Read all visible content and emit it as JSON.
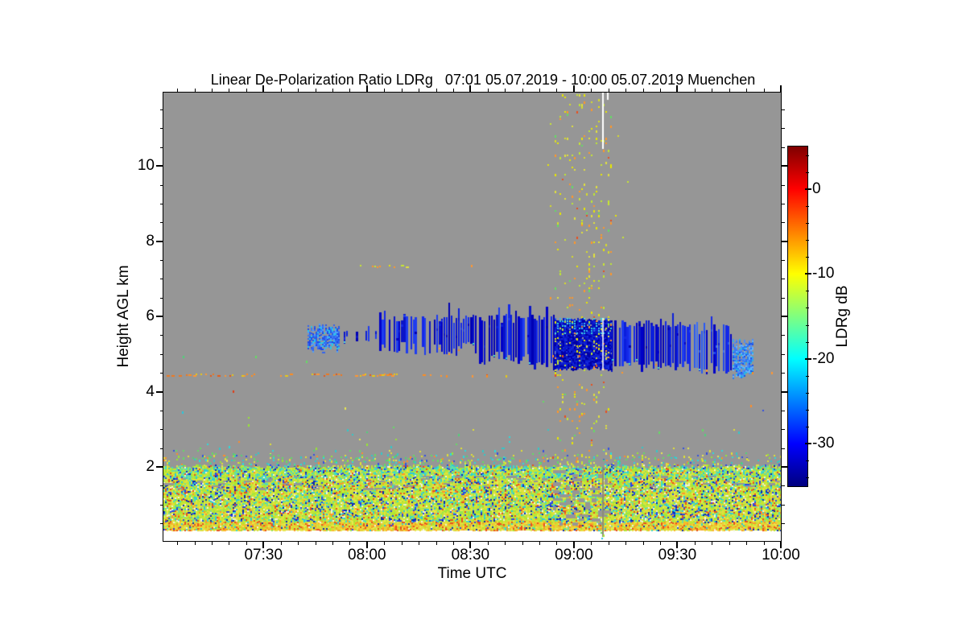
{
  "chart_data": {
    "type": "heatmap",
    "title": "Linear De-Polarization Ratio LDRg   07:01 05.07.2019 - 10:00 05.07.2019 Muenchen",
    "xlabel": "Time UTC",
    "ylabel": "Height AGL km",
    "site": "Muenchen",
    "time_range": {
      "start": "07:01 05.07.2019",
      "end": "10:00 05.07.2019"
    },
    "x_axis": {
      "unit": "UTC",
      "start_minutes": 421,
      "end_minutes": 600,
      "major_ticks": [
        {
          "t": 450,
          "label": "07:30"
        },
        {
          "t": 480,
          "label": "08:00"
        },
        {
          "t": 510,
          "label": "08:30"
        },
        {
          "t": 540,
          "label": "09:00"
        },
        {
          "t": 570,
          "label": "09:30"
        },
        {
          "t": 600,
          "label": "10:00"
        }
      ],
      "minor_step_minutes": 5
    },
    "y_axis": {
      "unit": "km",
      "min": 0,
      "max": 11.95,
      "major_ticks": [
        {
          "h": 2,
          "label": "2"
        },
        {
          "h": 4,
          "label": "4"
        },
        {
          "h": 6,
          "label": "6"
        },
        {
          "h": 8,
          "label": "8"
        },
        {
          "h": 10,
          "label": "10"
        }
      ],
      "minor_step_km": 0.5,
      "data_min_height_km": 0.31
    },
    "colorbar": {
      "label": "LDRg dB",
      "min": -35,
      "max": 5,
      "major_ticks": [
        {
          "v": 0,
          "label": "0"
        },
        {
          "v": -10,
          "label": "-10"
        },
        {
          "v": -20,
          "label": "-20"
        },
        {
          "v": -30,
          "label": "-30"
        }
      ],
      "minor_step_db": 2,
      "stops": [
        [
          0,
          "#00007F"
        ],
        [
          0.125,
          "#0000FF"
        ],
        [
          0.375,
          "#00FFFF"
        ],
        [
          0.625,
          "#FFFF00"
        ],
        [
          0.875,
          "#FF0000"
        ],
        [
          1,
          "#7F0000"
        ]
      ]
    },
    "background_nodata_color": "#969696",
    "palettes": {
      "column": [
        "#E8E800",
        "#E1E13C",
        "#E8E800",
        "#D7DC28",
        "#BEE632",
        "#E8E800",
        "#C8E632",
        "#FF9628",
        "#64DC64",
        "#E1E13C",
        "#E8E800",
        "#BEE632",
        "#FF9628",
        "#E8501E"
      ],
      "fringe": [
        "#64DC64",
        "#32C8C8",
        "#E1E132",
        "#3250E1",
        "#FF8C28",
        "#96E632",
        "#28DCDC",
        "#64DC64",
        "#E1E132",
        "#32C8C8",
        "#50D278",
        "#E8E850"
      ],
      "greens": [
        "#64DC64",
        "#50D278",
        "#78DC96"
      ],
      "oranges": [
        "#FF8C1E",
        "#F0781E",
        "#E85A14",
        "#E8C814",
        "#FF9632"
      ],
      "yellows": [
        "#E8E800",
        "#C8E632",
        "#FF9628",
        "#E1E13C"
      ],
      "blues": [
        "#0000C8",
        "#0A1EDC",
        "#1428E8",
        "#0000B4",
        "#1E3CF0",
        "#0A14C8"
      ],
      "blues2": [
        "#0A1EDC",
        "#1E46F0",
        "#2858F5",
        "#0000C8",
        "#3C6EF5",
        "#1428E8"
      ],
      "lightblues": [
        "#3C78F0",
        "#2858E8",
        "#50A0FA",
        "#1E46E8",
        "#28C8E8",
        "#3264F0"
      ],
      "lightblues2": [
        "#3C78F0",
        "#508CF5",
        "#28B4E8",
        "#1E50E8",
        "#64B4FA",
        "#2878F0"
      ],
      "blues_dark": [
        "#0000B4",
        "#0A14C8",
        "#0000A0",
        "#1428DC",
        "#0A1EC8"
      ],
      "cap": [
        "#28C8E8",
        "#3CB4F0",
        "#50DCE1",
        "#2864F5",
        "#32D7D7"
      ],
      "cyan_accent": [
        "#28DCDC",
        "#3CE1C8",
        "#50DCE1"
      ],
      "orange_accent": [
        "#FF9628",
        "#F0821E"
      ],
      "bottom_low": [
        "#E8D232",
        "#E8E13C",
        "#FFB428",
        "#E8E850",
        "#F0A028",
        "#E1D23C",
        "#E8501E"
      ],
      "bottom_mid": [
        "#E1E13C",
        "#D7E146",
        "#C8E632",
        "#BEE632",
        "#A8E632",
        "#E1E13C",
        "#C8E632",
        "#96E650",
        "#3CDCC8",
        "#28C8DC",
        "#E1E13C",
        "#BEE632",
        "#FF9628",
        "#E8501E",
        "#2846E8",
        "#A8E632",
        "#C8E632",
        "#78DC96",
        "#E8E850",
        "#0A28B4",
        "#F0F0DC"
      ],
      "bottom_top": [
        "#3CDCC8",
        "#28C8DC",
        "#50E1B4",
        "#78DC96",
        "#A8E632",
        "#C8E632",
        "#64DCA0",
        "#E1E13C",
        "#2846E8",
        "#BEE632",
        "#3CDCC8",
        "#96E650"
      ]
    },
    "features": [
      {
        "type": "bottom_layer",
        "t": [
          421,
          600
        ],
        "h": [
          0.31,
          2.0
        ]
      },
      {
        "type": "gray_dashes",
        "t": [
          421,
          600
        ],
        "h": [
          1.42,
          1.75
        ],
        "density": 0.1
      },
      {
        "type": "gray_blocks",
        "t": [
          534,
          550
        ],
        "h": [
          0.5,
          1.9
        ],
        "density": 0.3
      },
      {
        "type": "vline_gray",
        "t": 548.2,
        "h": [
          0.12,
          2.0
        ],
        "color": "#8C8C78"
      },
      {
        "type": "speckle",
        "t": [
          421,
          600
        ],
        "h": [
          2.0,
          2.5
        ],
        "density": 0.05,
        "palette": "fringe"
      },
      {
        "type": "speckle",
        "t": [
          421,
          600
        ],
        "h": [
          2.5,
          3.0
        ],
        "density": 0.012,
        "palette": "fringe"
      },
      {
        "type": "speckle",
        "t": [
          421,
          600
        ],
        "h": [
          3.0,
          3.7
        ],
        "density": 0.003,
        "palette": "fringe"
      },
      {
        "type": "speckle",
        "t": [
          421,
          481
        ],
        "h": [
          4.78,
          4.95
        ],
        "density": 0.02,
        "palette": "greens"
      },
      {
        "type": "cloud_patch",
        "t": [
          463,
          472
        ],
        "h": [
          5.05,
          5.8
        ],
        "density": 0.82,
        "palette": "lightblues"
      },
      {
        "type": "vstreaks",
        "t": [
          472,
          483
        ],
        "top": [
          5.5,
          5.7
        ],
        "base": [
          5.25,
          5.45
        ],
        "density": 0.3,
        "palette": "blues"
      },
      {
        "type": "vstreaks",
        "t": [
          483,
          494
        ],
        "top": [
          5.75,
          6.0
        ],
        "base": [
          5.0,
          5.35
        ],
        "density": 0.6,
        "palette": "blues"
      },
      {
        "type": "vstreaks",
        "t": [
          494,
          512
        ],
        "top": [
          5.8,
          6.05
        ],
        "base": [
          4.95,
          5.3
        ],
        "density": 0.72,
        "palette": "blues"
      },
      {
        "type": "vstreaks",
        "t": [
          512,
          527
        ],
        "top": [
          5.8,
          6.05
        ],
        "base": [
          4.7,
          5.1
        ],
        "density": 0.78,
        "palette": "blues"
      },
      {
        "type": "vstreaks",
        "t": [
          527,
          535
        ],
        "top": [
          5.85,
          6.05
        ],
        "base": [
          4.55,
          4.9
        ],
        "density": 0.85,
        "palette": "blues"
      },
      {
        "type": "cloud_block",
        "t": [
          534.6,
          551
        ],
        "h": [
          4.55,
          5.95
        ],
        "cap": [
          5.55,
          5.95
        ]
      },
      {
        "type": "vstreaks",
        "t": [
          551,
          572
        ],
        "top": [
          5.7,
          5.95
        ],
        "base": [
          4.5,
          4.8
        ],
        "density": 0.8,
        "palette": "blues"
      },
      {
        "type": "vstreaks",
        "t": [
          572,
          586
        ],
        "top": [
          5.5,
          5.85
        ],
        "base": [
          4.45,
          4.8
        ],
        "density": 0.75,
        "palette": "blues2"
      },
      {
        "type": "cloud_patch",
        "t": [
          586,
          592
        ],
        "h": [
          4.35,
          5.4
        ],
        "density": 0.8,
        "palette": "lightblues2"
      },
      {
        "type": "speckle",
        "t": [
          534.5,
          551
        ],
        "h": [
          2.05,
          11.9
        ],
        "density": 0.07,
        "palette": "column"
      },
      {
        "type": "speckle",
        "t": [
          531,
          556
        ],
        "h": [
          2.05,
          11.9
        ],
        "density": 0.006,
        "palette": "column"
      },
      {
        "type": "hdots",
        "t": [
          422,
          500
        ],
        "h": 4.46,
        "density": 0.4,
        "palette": "oranges"
      },
      {
        "type": "hdots",
        "t": [
          500,
          521
        ],
        "h": 4.44,
        "density": 0.15,
        "palette": "oranges"
      },
      {
        "type": "hdots",
        "t": [
          478,
          492
        ],
        "h": 7.33,
        "density": 0.55,
        "palette": "yellows"
      },
      {
        "type": "dots",
        "pts": [
          [
            441.3,
            4.03,
            "#E13C14"
          ],
          [
            426.4,
            3.46,
            "#28C8DC"
          ],
          [
            510.2,
            7.37,
            "#FF9632"
          ],
          [
            503.1,
            4.42,
            "#FF8C1E"
          ],
          [
            510.4,
            4.42,
            "#FF9632"
          ],
          [
            514.6,
            4.42,
            "#FF8C1E"
          ],
          [
            520.2,
            4.44,
            "#E8C814"
          ],
          [
            578.5,
            4.57,
            "#FF9632"
          ],
          [
            591.8,
            4.52,
            "#FF8C1E"
          ],
          [
            597.2,
            4.52,
            "#FF9632"
          ]
        ]
      },
      {
        "type": "vline_white",
        "t": 548.2,
        "h": [
          10.42,
          11.93
        ]
      },
      {
        "type": "vline_white",
        "t": 549.6,
        "h": [
          11.72,
          11.93
        ]
      },
      {
        "type": "vline_pale",
        "t": 548.2,
        "h": [
          4.55,
          5.95
        ]
      }
    ]
  }
}
